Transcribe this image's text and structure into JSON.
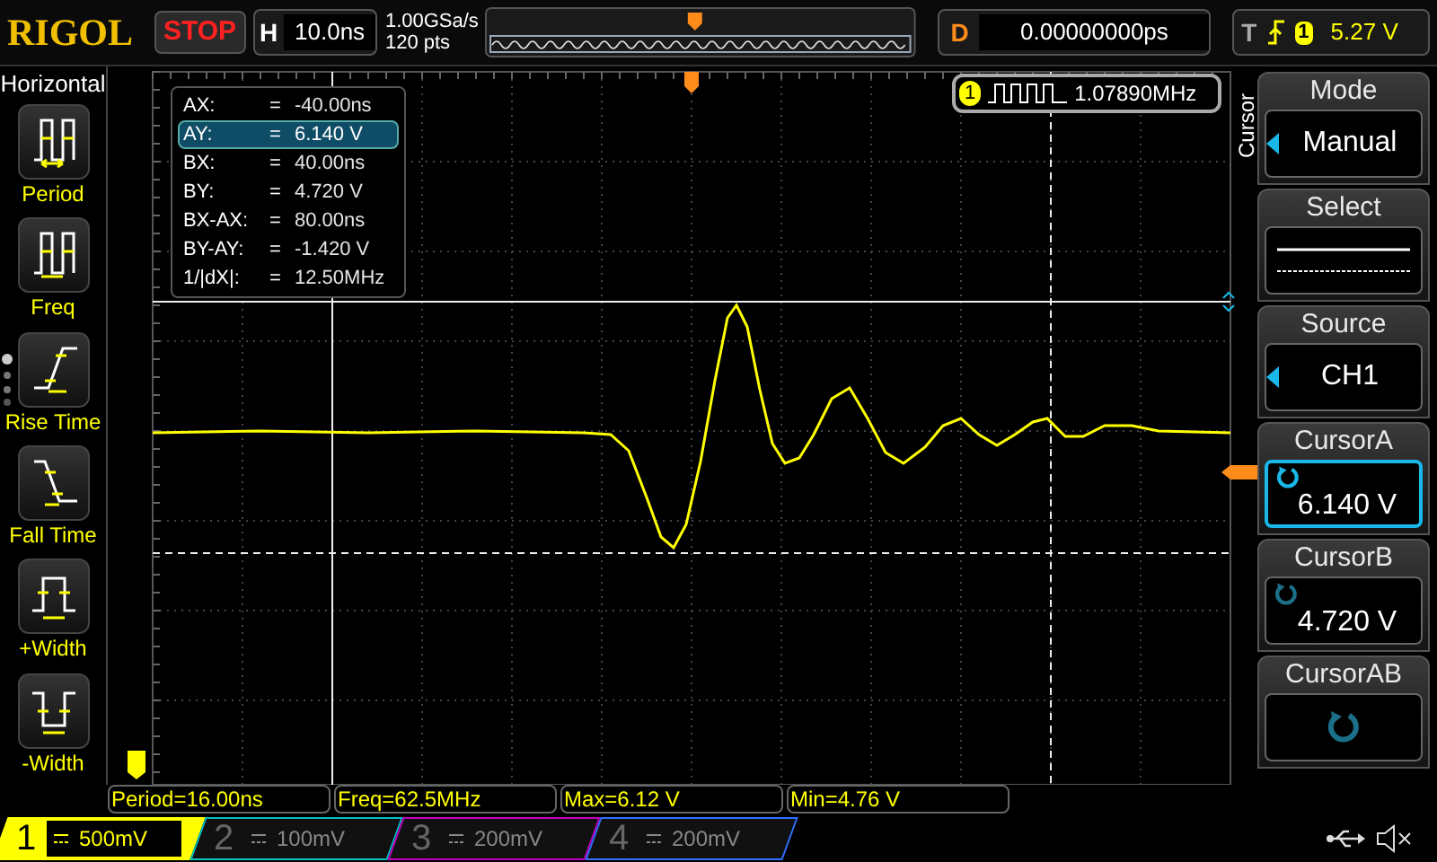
{
  "brand": "RIGOL",
  "run_state": "STOP",
  "timebase": {
    "label": "H",
    "value": "10.0ns"
  },
  "sample_rate": "1.00GSa/s",
  "memory_depth": "120 pts",
  "delay": {
    "label": "D",
    "value": "0.00000000ps"
  },
  "trigger": {
    "label": "T",
    "source": "1",
    "level": "5.27 V"
  },
  "left_menu": {
    "title": "Horizontal",
    "items": [
      {
        "kind": "period",
        "label": "Period"
      },
      {
        "kind": "freq",
        "label": "Freq"
      },
      {
        "kind": "rise",
        "label": "Rise Time"
      },
      {
        "kind": "fall",
        "label": "Fall Time"
      },
      {
        "kind": "pwidth",
        "label": "+Width"
      },
      {
        "kind": "nwidth",
        "label": "-Width"
      }
    ]
  },
  "cursor_readout": [
    {
      "label": "AX:",
      "eq": "=",
      "value": "-40.00ns",
      "selected": false
    },
    {
      "label": "AY:",
      "eq": "=",
      "value": "6.140 V",
      "selected": true
    },
    {
      "label": "BX:",
      "eq": "=",
      "value": "40.00ns",
      "selected": false
    },
    {
      "label": "BY:",
      "eq": "=",
      "value": "4.720 V",
      "selected": false
    },
    {
      "label": "BX-AX:",
      "eq": "=",
      "value": "80.00ns",
      "selected": false
    },
    {
      "label": "BY-AY:",
      "eq": "=",
      "value": "-1.420 V",
      "selected": false
    },
    {
      "label": "1/|dX|:",
      "eq": "=",
      "value": "12.50MHz",
      "selected": false
    }
  ],
  "frequency_counter": {
    "channel": "1",
    "value": "1.07890MHz"
  },
  "measurements": [
    "Period=16.00ns",
    "Freq=62.5MHz",
    "Max=6.12 V",
    "Min=4.76 V"
  ],
  "channels": [
    {
      "number": "1",
      "scale": "500mV",
      "selected": true,
      "color": "#ffff00"
    },
    {
      "number": "2",
      "scale": "100mV",
      "selected": false,
      "color": "#00c0c0"
    },
    {
      "number": "3",
      "scale": "200mV",
      "selected": false,
      "color": "#c000c0"
    },
    {
      "number": "4",
      "scale": "200mV",
      "selected": false,
      "color": "#3070ff"
    }
  ],
  "right_menu": {
    "title": "Cursor",
    "items": [
      {
        "kind": "select",
        "label": "Mode",
        "value": "Manual"
      },
      {
        "kind": "line-style",
        "label": "Select"
      },
      {
        "kind": "select",
        "label": "Source",
        "value": "CH1"
      },
      {
        "kind": "knob",
        "label": "CursorA",
        "value": "6.140 V",
        "active": true
      },
      {
        "kind": "knob",
        "label": "CursorB",
        "value": "4.720 V",
        "active": false
      },
      {
        "kind": "knob",
        "label": "CursorAB",
        "active": false
      }
    ]
  }
}
